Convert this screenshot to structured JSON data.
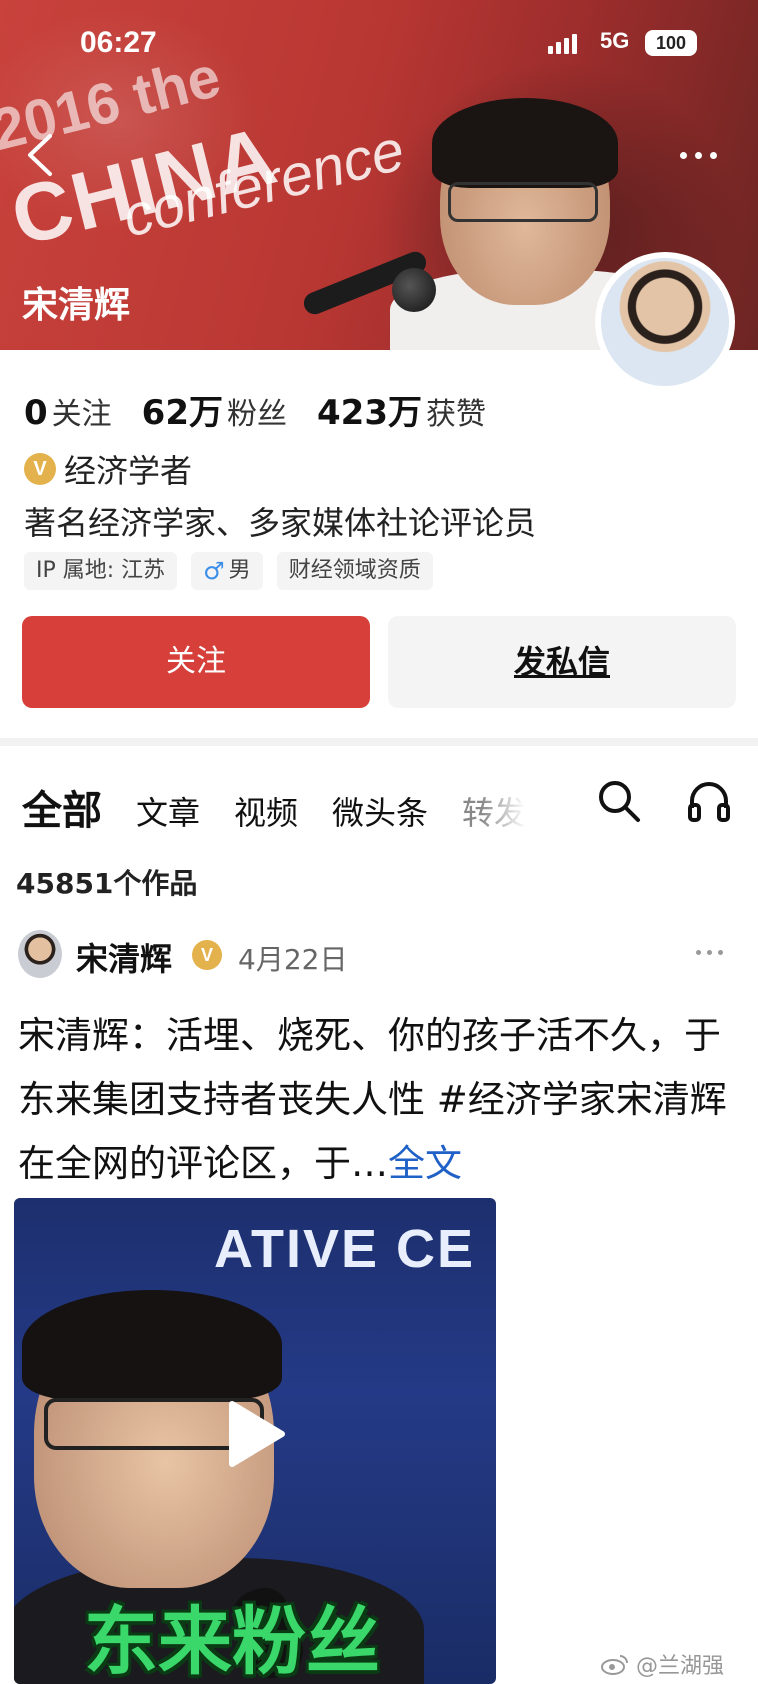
{
  "status_bar": {
    "time": "06:27",
    "network": "5G",
    "battery": "100"
  },
  "banner": {
    "bg_text_1": "2016 the",
    "bg_text_2": "CHINA",
    "bg_text_3": "conference",
    "profile_name": "宋清辉"
  },
  "stats": [
    {
      "num": "0",
      "label": "关注"
    },
    {
      "num": "62万",
      "label": "粉丝"
    },
    {
      "num": "423万",
      "label": "获赞"
    }
  ],
  "verification": {
    "badge": "V",
    "title": "经济学者"
  },
  "bio": "著名经济学家、多家媒体社论评论员",
  "tags": {
    "ip": "IP 属地: 江苏",
    "gender_symbol": "♂",
    "gender": "男",
    "qualification": "财经领域资质"
  },
  "buttons": {
    "follow": "关注",
    "message": "发私信"
  },
  "tabs": [
    "全部",
    "文章",
    "视频",
    "微头条",
    "转发"
  ],
  "works_count": "45851个作品",
  "post": {
    "author": "宋清辉",
    "badge": "V",
    "date": "4月22日",
    "text": "宋清辉：活埋、烧死、你的孩子活不久，于东来集团支持者丧失人性 #经济学家宋清辉 在全网的评论区，于…",
    "more_link": "全文",
    "video": {
      "caption_top": "ATIVE CE",
      "caption_bottom": "东来粉丝"
    }
  },
  "watermark": "@兰湖强",
  "colors": {
    "accent": "#d63f3a",
    "link": "#1f61c7",
    "badge": "#e3b24c"
  }
}
